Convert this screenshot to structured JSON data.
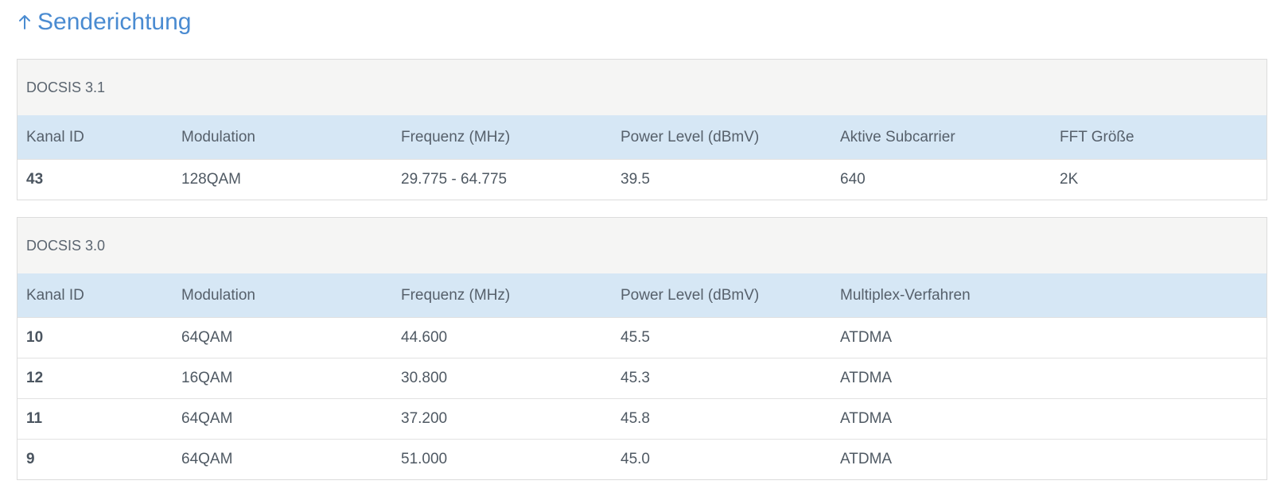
{
  "section": {
    "title": "Senderichtung",
    "icon": "arrow-up-icon",
    "accent_color": "#4a8bd1"
  },
  "docsis31": {
    "header": "DOCSIS 3.1",
    "columns": [
      "Kanal ID",
      "Modulation",
      "Frequenz (MHz)",
      "Power Level (dBmV)",
      "Aktive Subcarrier",
      "FFT Größe"
    ],
    "rows": [
      [
        "43",
        "128QAM",
        "29.775 - 64.775",
        "39.5",
        "640",
        "2K"
      ]
    ]
  },
  "docsis30": {
    "header": "DOCSIS 3.0",
    "columns": [
      "Kanal ID",
      "Modulation",
      "Frequenz (MHz)",
      "Power Level (dBmV)",
      "Multiplex-Verfahren"
    ],
    "rows": [
      [
        "10",
        "64QAM",
        "44.600",
        "45.5",
        "ATDMA"
      ],
      [
        "12",
        "16QAM",
        "30.800",
        "45.3",
        "ATDMA"
      ],
      [
        "11",
        "64QAM",
        "37.200",
        "45.8",
        "ATDMA"
      ],
      [
        "9",
        "64QAM",
        "51.000",
        "45.0",
        "ATDMA"
      ]
    ]
  }
}
